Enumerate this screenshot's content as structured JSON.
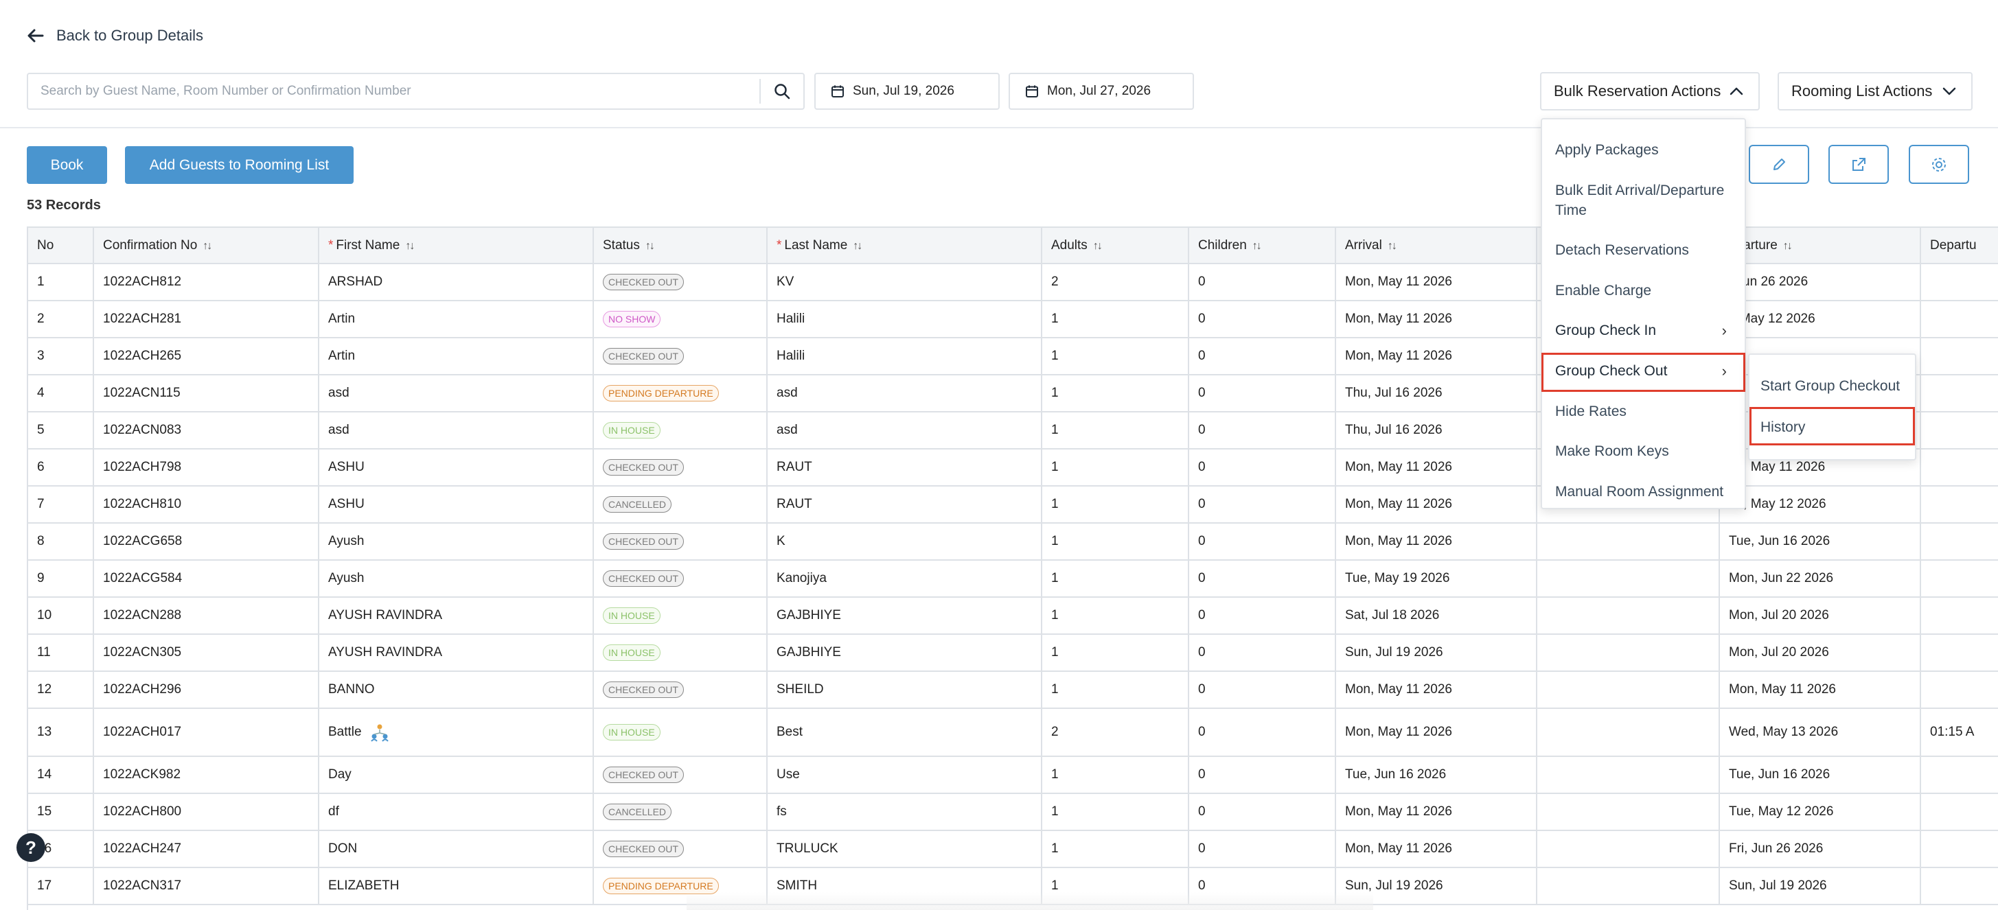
{
  "header": {
    "back_label": "Back to Group Details",
    "search_placeholder": "Search by Guest Name, Room Number or Confirmation Number",
    "date_from": "Sun, Jul 19, 2026",
    "date_to": "Mon, Jul 27, 2026",
    "bulk_actions_label": "Bulk Reservation Actions",
    "rooming_actions_label": "Rooming List Actions"
  },
  "toolbar": {
    "book_label": "Book",
    "add_guests_label": "Add Guests to Rooming List",
    "records_count": "53 Records"
  },
  "table": {
    "columns": {
      "no": "No",
      "confirmation": "Confirmation No",
      "first_name": "First Name",
      "status": "Status",
      "last_name": "Last Name",
      "adults": "Adults",
      "children": "Children",
      "arrival": "Arrival",
      "departure": "eparture",
      "departure_time": "Departu"
    },
    "rows": [
      {
        "no": "1",
        "conf": "1022ACH812",
        "first": "ARSHAD",
        "status": "CHECKED OUT",
        "last": "KV",
        "adults": "2",
        "children": "0",
        "arrival": "Mon, May 11 2026",
        "departure": ", Jun 26 2026",
        "dep_time": ""
      },
      {
        "no": "2",
        "conf": "1022ACH281",
        "first": "Artin",
        "status": "NO SHOW",
        "last": "Halili",
        "adults": "1",
        "children": "0",
        "arrival": "Mon, May 11 2026",
        "departure": "., May 12 2026",
        "dep_time": ""
      },
      {
        "no": "3",
        "conf": "1022ACH265",
        "first": "Artin",
        "status": "CHECKED OUT",
        "last": "Halili",
        "adults": "1",
        "children": "0",
        "arrival": "Mon, May 11 2026",
        "departure": "",
        "dep_time": ""
      },
      {
        "no": "4",
        "conf": "1022ACN115",
        "first": "asd",
        "status": "PENDING DEPARTURE",
        "last": "asd",
        "adults": "1",
        "children": "0",
        "arrival": "Thu, Jul 16 2026",
        "departure": "",
        "dep_time": ""
      },
      {
        "no": "5",
        "conf": "1022ACN083",
        "first": "asd",
        "status": "IN HOUSE",
        "last": "asd",
        "adults": "1",
        "children": "0",
        "arrival": "Thu, Jul 16 2026",
        "departure": "",
        "dep_time": ""
      },
      {
        "no": "6",
        "conf": "1022ACH798",
        "first": "ASHU",
        "status": "CHECKED OUT",
        "last": "RAUT",
        "adults": "1",
        "children": "0",
        "arrival": "Mon, May 11 2026",
        "departure": "on, May 11 2026",
        "dep_time": ""
      },
      {
        "no": "7",
        "conf": "1022ACH810",
        "first": "ASHU",
        "status": "CANCELLED",
        "last": "RAUT",
        "adults": "1",
        "children": "0",
        "arrival": "Mon, May 11 2026",
        "departure": "ue, May 12 2026",
        "dep_time": ""
      },
      {
        "no": "8",
        "conf": "1022ACG658",
        "first": "Ayush",
        "status": "CHECKED OUT",
        "last": "K",
        "adults": "1",
        "children": "0",
        "arrival": "Mon, May 11 2026",
        "departure": "Tue, Jun 16 2026",
        "dep_time": ""
      },
      {
        "no": "9",
        "conf": "1022ACG584",
        "first": "Ayush",
        "status": "CHECKED OUT",
        "last": "Kanojiya",
        "adults": "1",
        "children": "0",
        "arrival": "Tue, May 19 2026",
        "departure": "Mon, Jun 22 2026",
        "dep_time": ""
      },
      {
        "no": "10",
        "conf": "1022ACN288",
        "first": "AYUSH RAVINDRA",
        "status": "IN HOUSE",
        "last": "GAJBHIYE",
        "adults": "1",
        "children": "0",
        "arrival": "Sat, Jul 18 2026",
        "departure": "Mon, Jul 20 2026",
        "dep_time": ""
      },
      {
        "no": "11",
        "conf": "1022ACN305",
        "first": "AYUSH RAVINDRA",
        "status": "IN HOUSE",
        "last": "GAJBHIYE",
        "adults": "1",
        "children": "0",
        "arrival": "Sun, Jul 19 2026",
        "departure": "Mon, Jul 20 2026",
        "dep_time": ""
      },
      {
        "no": "12",
        "conf": "1022ACH296",
        "first": "BANNO",
        "status": "CHECKED OUT",
        "last": "SHEILD",
        "adults": "1",
        "children": "0",
        "arrival": "Mon, May 11 2026",
        "departure": "Mon, May 11 2026",
        "dep_time": ""
      },
      {
        "no": "13",
        "conf": "1022ACH017",
        "first": "Battle",
        "status": "IN HOUSE",
        "last": "Best",
        "adults": "2",
        "children": "0",
        "arrival": "Mon, May 11 2026",
        "departure": "Wed, May 13 2026",
        "dep_time": "01:15 A"
      },
      {
        "no": "14",
        "conf": "1022ACK982",
        "first": "Day",
        "status": "CHECKED OUT",
        "last": "Use",
        "adults": "1",
        "children": "0",
        "arrival": "Tue, Jun 16 2026",
        "departure": "Tue, Jun 16 2026",
        "dep_time": ""
      },
      {
        "no": "15",
        "conf": "1022ACH800",
        "first": "df",
        "status": "CANCELLED",
        "last": "fs",
        "adults": "1",
        "children": "0",
        "arrival": "Mon, May 11 2026",
        "departure": "Tue, May 12 2026",
        "dep_time": ""
      },
      {
        "no": "16",
        "conf": "1022ACH247",
        "first": "DON",
        "status": "CHECKED OUT",
        "last": "TRULUCK",
        "adults": "1",
        "children": "0",
        "arrival": "Mon, May 11 2026",
        "departure": "Fri, Jun 26 2026",
        "dep_time": ""
      },
      {
        "no": "17",
        "conf": "1022ACN317",
        "first": "ELIZABETH",
        "status": "PENDING DEPARTURE",
        "last": "SMITH",
        "adults": "1",
        "children": "0",
        "arrival": "Sun, Jul 19 2026",
        "departure": "Sun, Jul 19 2026",
        "dep_time": ""
      }
    ]
  },
  "bulk_menu": {
    "items": [
      "Apply Packages",
      "Bulk Edit Arrival/Departure Time",
      "Detach Reservations",
      "Enable Charge",
      "Group Check In",
      "Group Check Out",
      "Hide Rates",
      "Make Room Keys",
      "Manual Room Assignment"
    ]
  },
  "submenu": {
    "items": [
      "Start Group Checkout",
      "History"
    ]
  },
  "help_label": "?",
  "colors": {
    "primary": "#4a95cf",
    "highlight": "#e03e2d"
  }
}
